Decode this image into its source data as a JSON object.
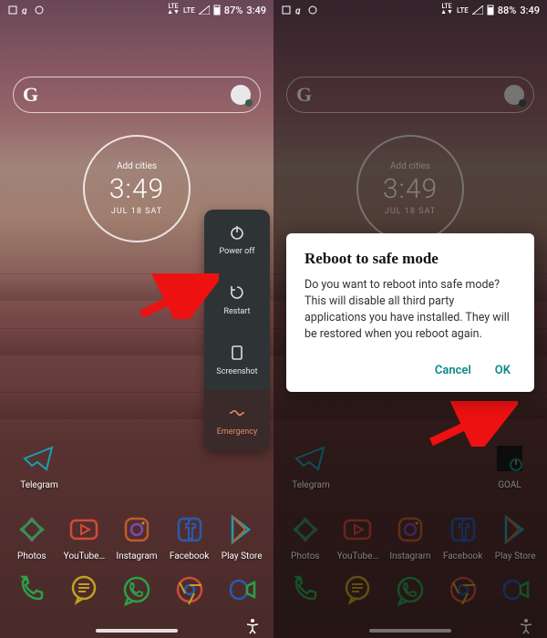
{
  "left": {
    "statusbar": {
      "battery_pct": "87%",
      "time": "3:49",
      "lte_top": "LTE",
      "lte_bottom": "LTE"
    },
    "search": {
      "letter": "G"
    },
    "clock": {
      "add": "Add cities",
      "time": "3:49",
      "date": "JUL 18 SAT"
    },
    "upper_apps": [
      {
        "label": "Telegram",
        "icon": "telegram-icon"
      }
    ],
    "apps": [
      {
        "label": "Photos",
        "icon": "photos-icon"
      },
      {
        "label": "YouTube…",
        "icon": "youtube-icon"
      },
      {
        "label": "Instagram",
        "icon": "instagram-icon"
      },
      {
        "label": "Facebook",
        "icon": "facebook-icon"
      },
      {
        "label": "Play Store",
        "icon": "playstore-icon"
      }
    ],
    "dock_icons": [
      "phone-icon",
      "messages-icon",
      "whatsapp-icon",
      "chrome-icon",
      "duo-icon"
    ],
    "power_menu": [
      {
        "label": "Power off",
        "icon": "power-icon",
        "variant": ""
      },
      {
        "label": "Restart",
        "icon": "restart-icon",
        "variant": ""
      },
      {
        "label": "Screenshot",
        "icon": "screenshot-icon",
        "variant": ""
      },
      {
        "label": "Emergency",
        "icon": "emergency-icon",
        "variant": "emergency"
      }
    ]
  },
  "right": {
    "statusbar": {
      "battery_pct": "88%",
      "time": "3:49",
      "lte_top": "LTE",
      "lte_bottom": "LTE"
    },
    "search": {
      "letter": "G"
    },
    "clock": {
      "add": "Add cities",
      "time": "3:49",
      "date": "JUL 18 SAT"
    },
    "upper_apps_left": [
      {
        "label": "Telegram",
        "icon": "telegram-icon"
      }
    ],
    "upper_apps_right": [
      {
        "label": "GOAL",
        "icon": "goal-icon"
      }
    ],
    "apps": [
      {
        "label": "Photos",
        "icon": "photos-icon"
      },
      {
        "label": "YouTube…",
        "icon": "youtube-icon"
      },
      {
        "label": "Instagram",
        "icon": "instagram-icon"
      },
      {
        "label": "Facebook",
        "icon": "facebook-icon"
      },
      {
        "label": "Play Store",
        "icon": "playstore-icon"
      }
    ],
    "dock_icons": [
      "phone-icon",
      "messages-icon",
      "whatsapp-icon",
      "chrome-icon",
      "duo-icon"
    ],
    "dialog": {
      "title": "Reboot to safe mode",
      "body": "Do you want to reboot into safe mode? This will disable all third party applications you have installed. They will be restored when you reboot again.",
      "cancel": "Cancel",
      "ok": "OK"
    }
  },
  "colors": {
    "accent": "#0a8a88",
    "emergency": "#e88a6a"
  }
}
